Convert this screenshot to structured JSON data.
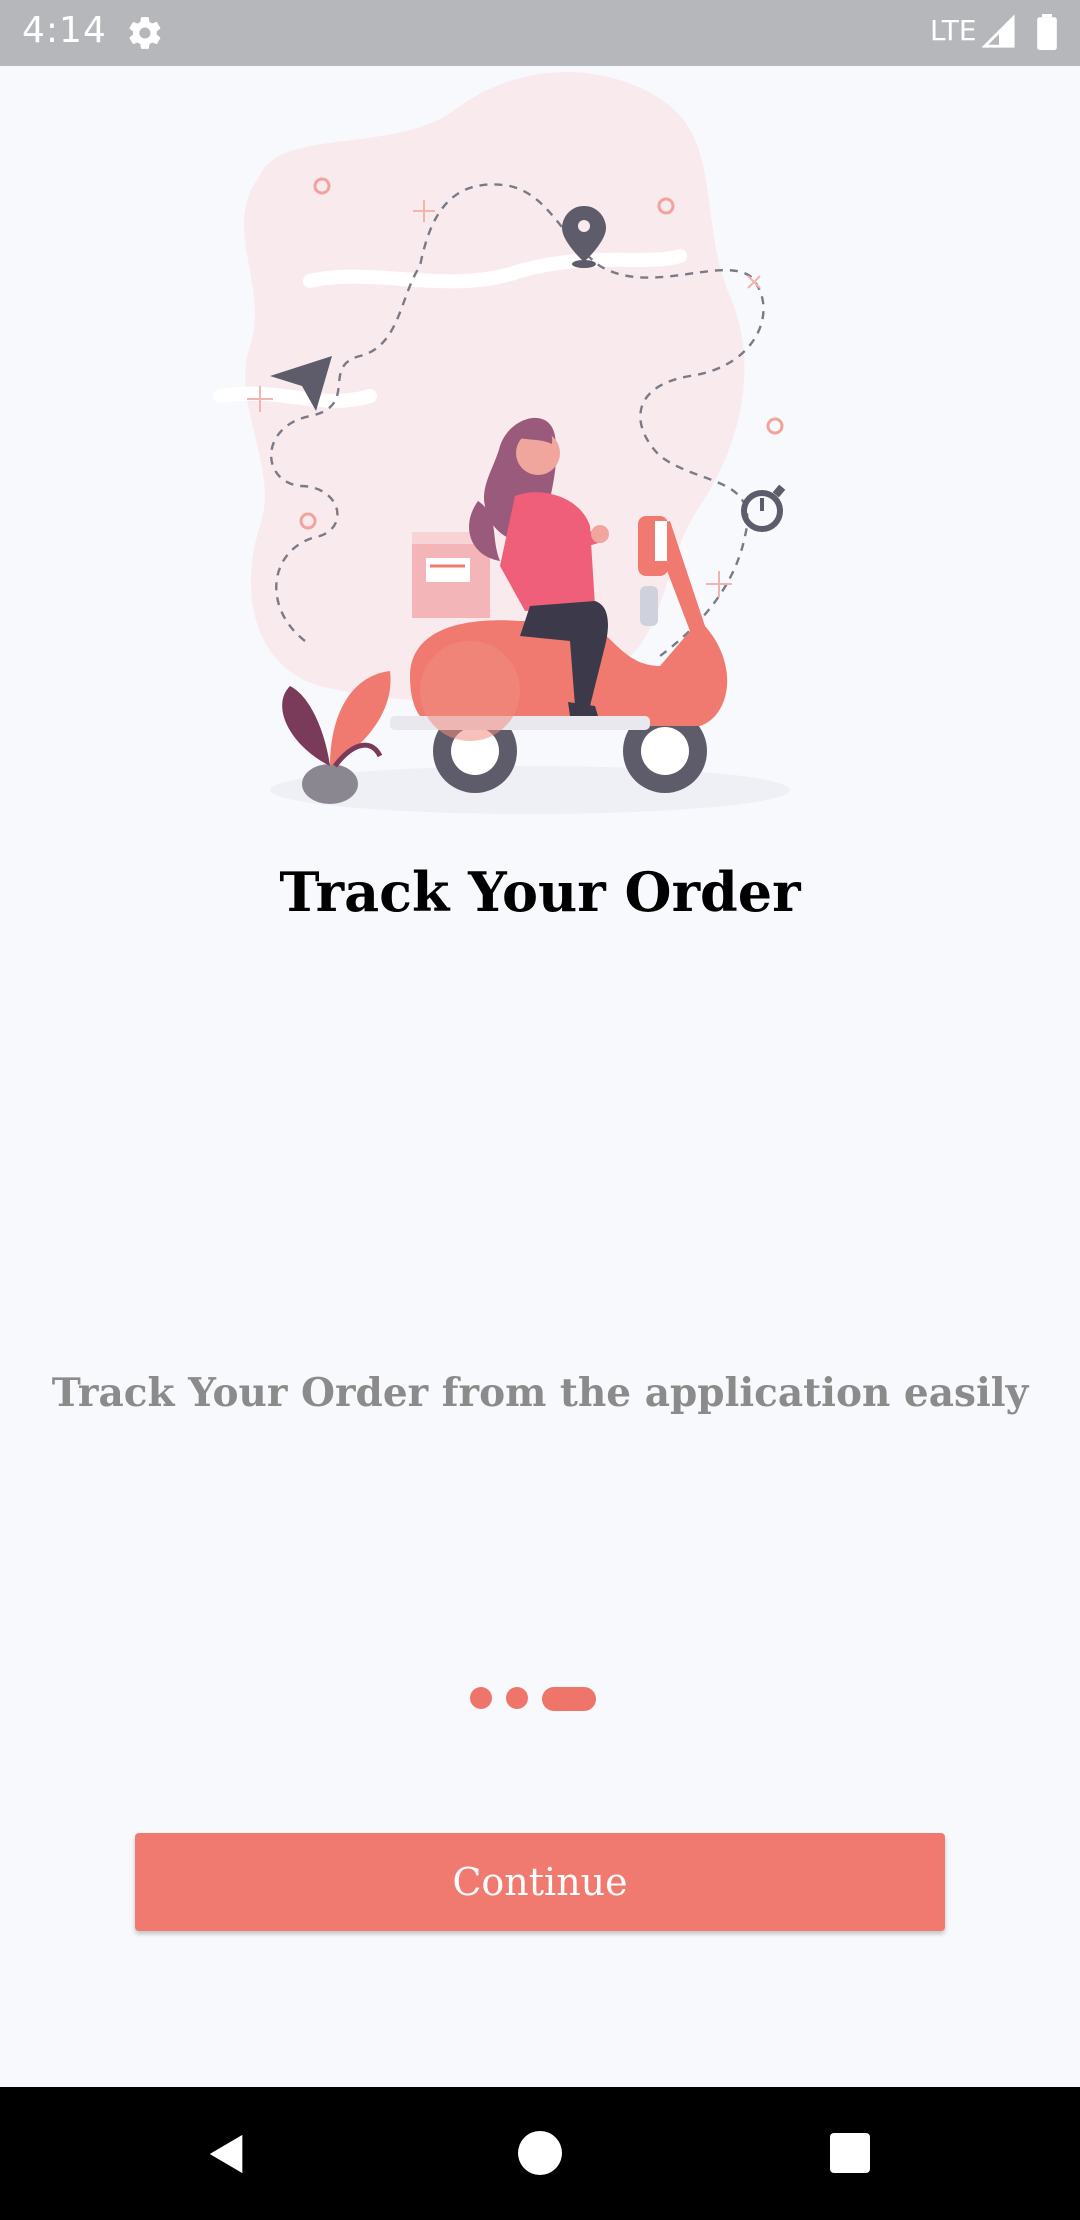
{
  "status_bar": {
    "time": "4:14",
    "network": "LTE",
    "icons": [
      "settings-gear-icon",
      "signal-icon",
      "battery-icon"
    ]
  },
  "onboarding": {
    "illustration": "delivery-scooter-illustration",
    "title": "Track Your Order",
    "subtitle": "Track Your Order from the application easily",
    "pager": {
      "total": 3,
      "active_index": 2
    },
    "continue_label": "Continue"
  },
  "nav_bar": {
    "icons": [
      "back-icon",
      "home-icon",
      "recents-icon"
    ]
  },
  "colors": {
    "accent": "#f07a6f",
    "background": "#f8f9fc",
    "status_bar": "#b6b7ba",
    "subtitle": "#8b8b8b"
  }
}
